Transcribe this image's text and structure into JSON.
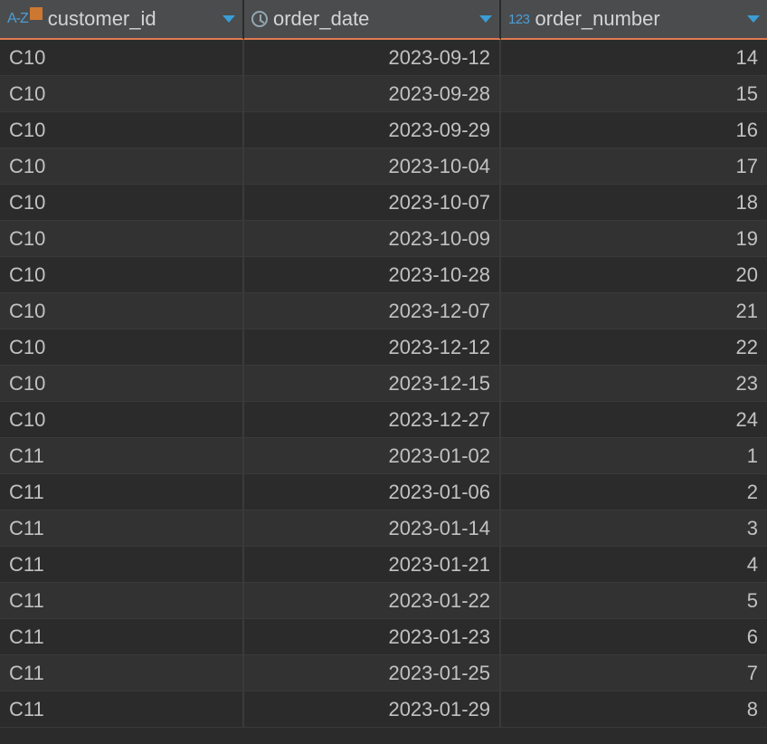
{
  "columns": [
    {
      "label": "customer_id",
      "type": "text-key",
      "align": "left"
    },
    {
      "label": "order_date",
      "type": "datetime",
      "align": "right"
    },
    {
      "label": "order_number",
      "type": "number",
      "align": "right"
    }
  ],
  "type_badges": {
    "text": "A-Z",
    "number": "123"
  },
  "rows": [
    {
      "customer_id": "C10",
      "order_date": "2023-09-12",
      "order_number": "14"
    },
    {
      "customer_id": "C10",
      "order_date": "2023-09-28",
      "order_number": "15"
    },
    {
      "customer_id": "C10",
      "order_date": "2023-09-29",
      "order_number": "16"
    },
    {
      "customer_id": "C10",
      "order_date": "2023-10-04",
      "order_number": "17"
    },
    {
      "customer_id": "C10",
      "order_date": "2023-10-07",
      "order_number": "18"
    },
    {
      "customer_id": "C10",
      "order_date": "2023-10-09",
      "order_number": "19"
    },
    {
      "customer_id": "C10",
      "order_date": "2023-10-28",
      "order_number": "20"
    },
    {
      "customer_id": "C10",
      "order_date": "2023-12-07",
      "order_number": "21"
    },
    {
      "customer_id": "C10",
      "order_date": "2023-12-12",
      "order_number": "22"
    },
    {
      "customer_id": "C10",
      "order_date": "2023-12-15",
      "order_number": "23"
    },
    {
      "customer_id": "C10",
      "order_date": "2023-12-27",
      "order_number": "24"
    },
    {
      "customer_id": "C11",
      "order_date": "2023-01-02",
      "order_number": "1"
    },
    {
      "customer_id": "C11",
      "order_date": "2023-01-06",
      "order_number": "2"
    },
    {
      "customer_id": "C11",
      "order_date": "2023-01-14",
      "order_number": "3"
    },
    {
      "customer_id": "C11",
      "order_date": "2023-01-21",
      "order_number": "4"
    },
    {
      "customer_id": "C11",
      "order_date": "2023-01-22",
      "order_number": "5"
    },
    {
      "customer_id": "C11",
      "order_date": "2023-01-23",
      "order_number": "6"
    },
    {
      "customer_id": "C11",
      "order_date": "2023-01-25",
      "order_number": "7"
    },
    {
      "customer_id": "C11",
      "order_date": "2023-01-29",
      "order_number": "8"
    }
  ]
}
